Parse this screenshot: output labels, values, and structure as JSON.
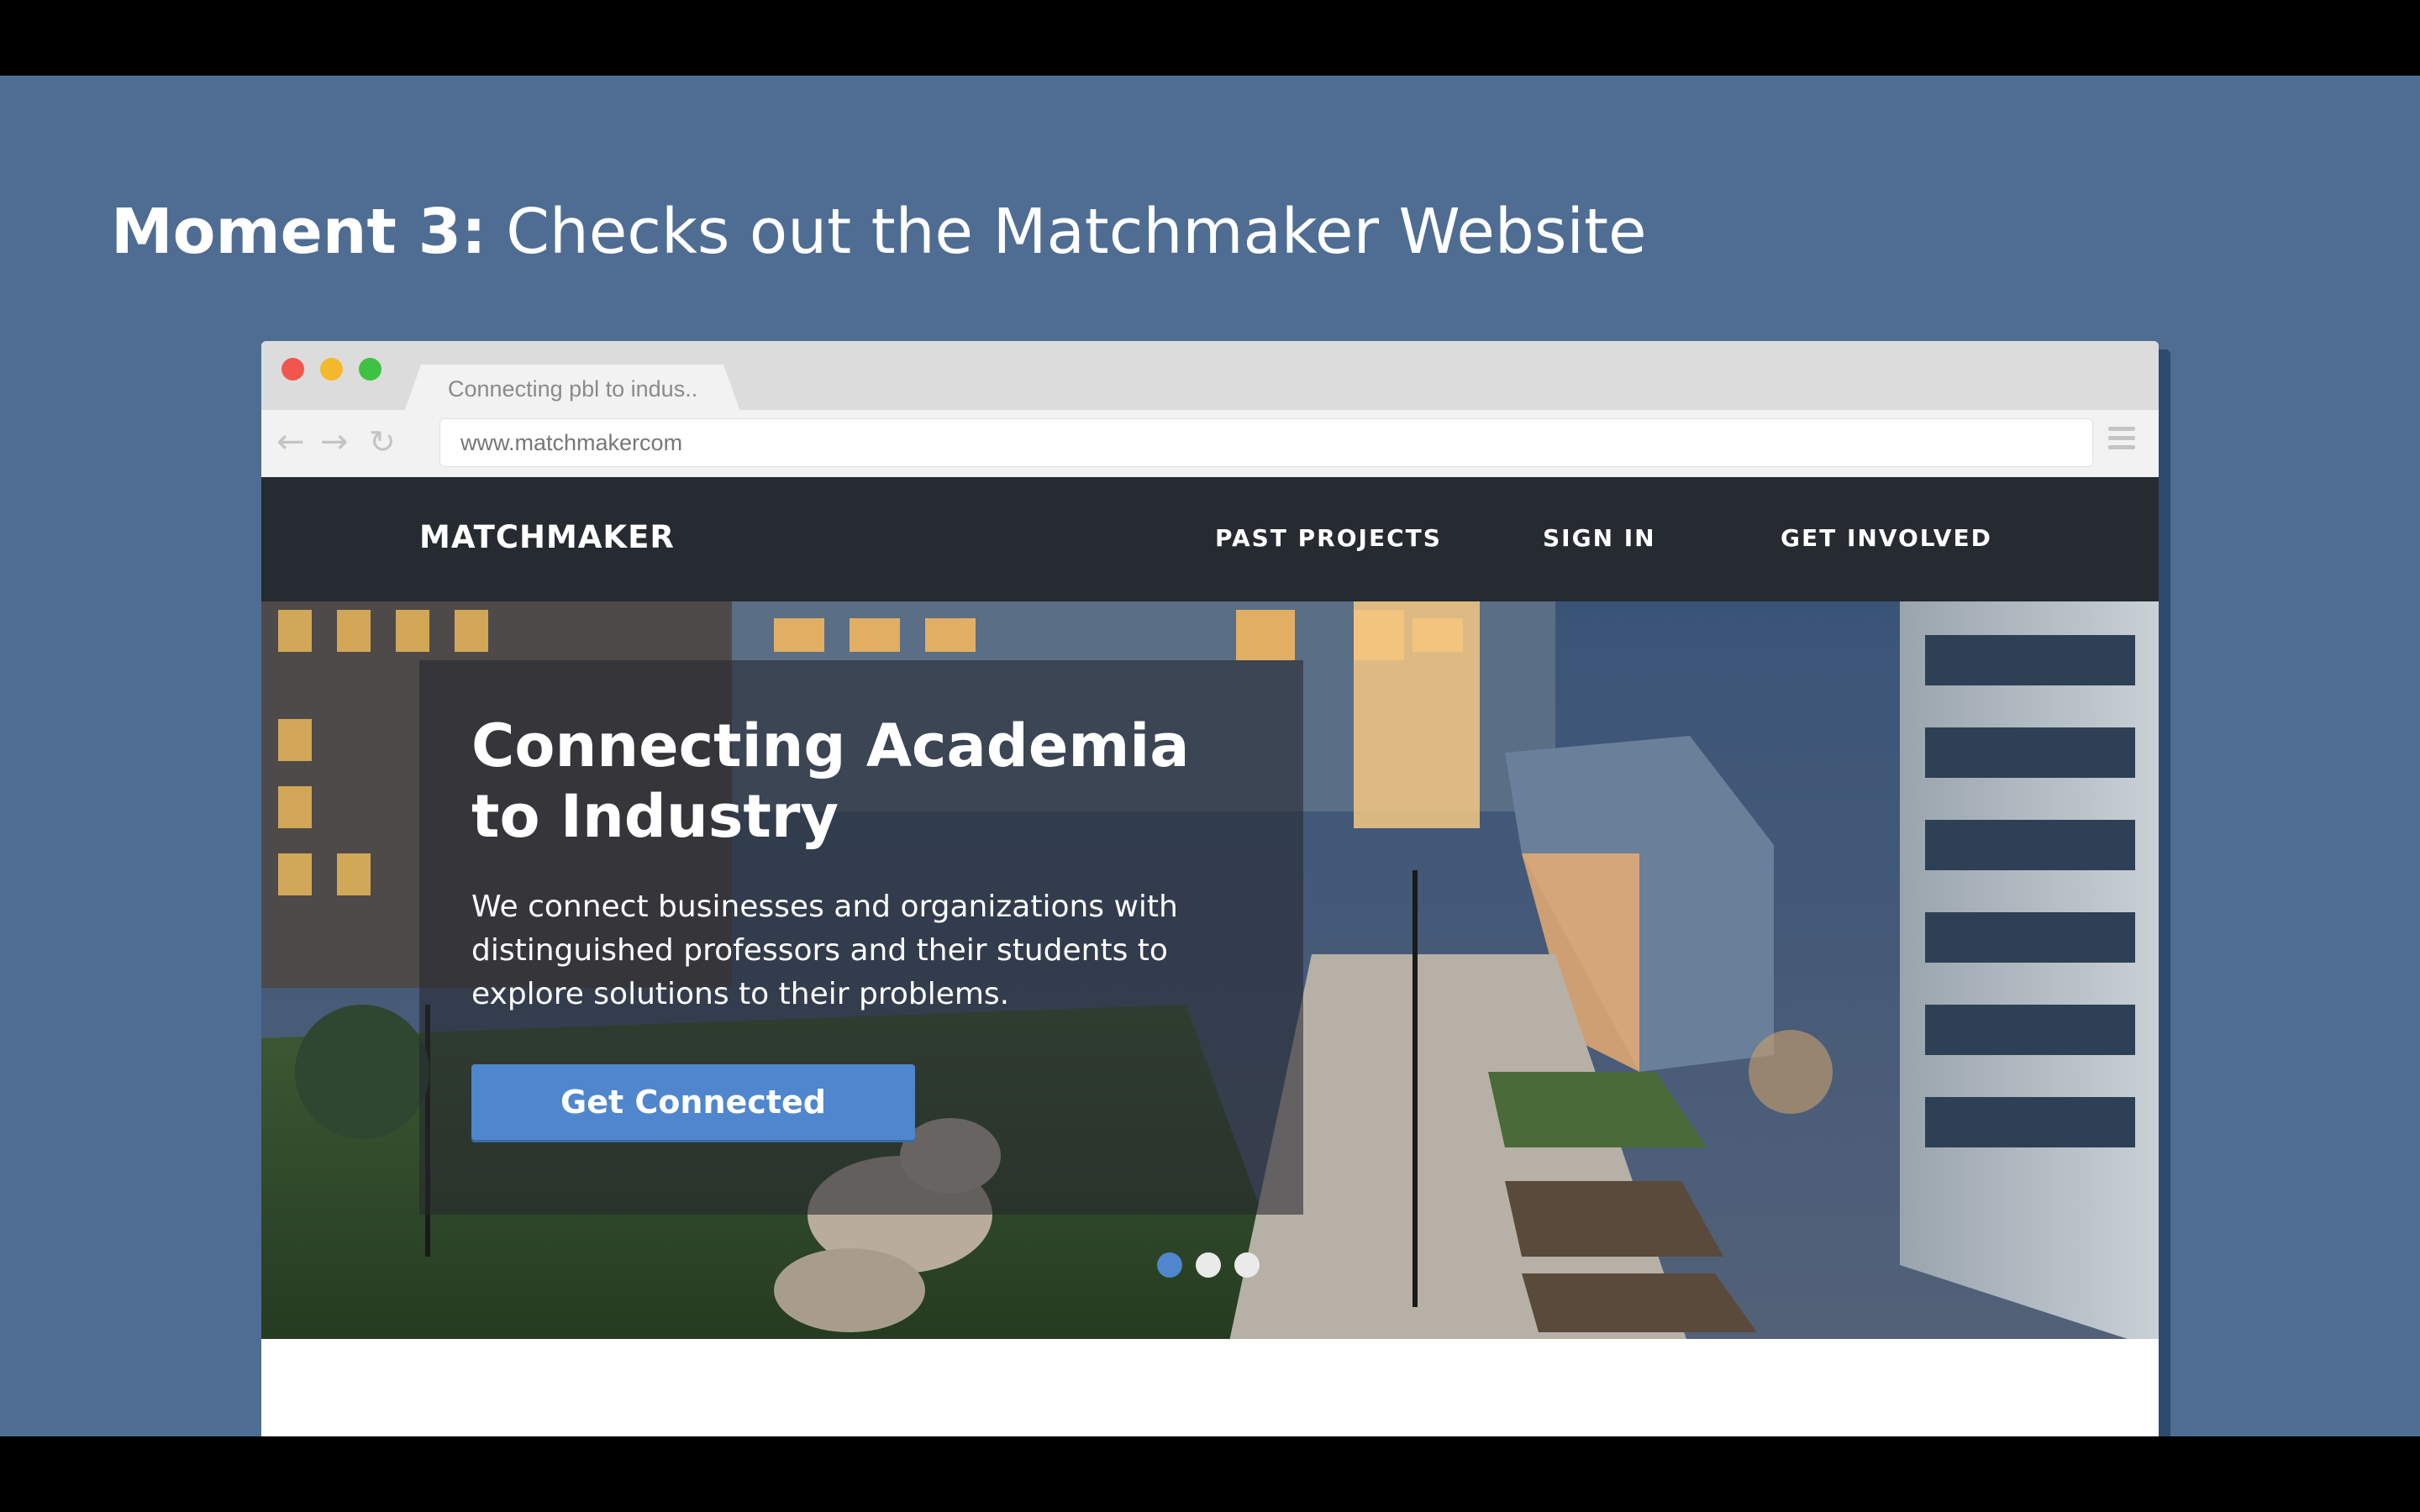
{
  "slide": {
    "title_bold": "Moment 3:",
    "title_rest": " Checks out the Matchmaker Website",
    "background_color": "#4f6d93"
  },
  "browser": {
    "tab_title": "Connecting pbl to indus..",
    "url": "www.matchmakercom",
    "icons": [
      "back-arrow-icon",
      "forward-arrow-icon",
      "reload-icon",
      "hamburger-menu-icon"
    ]
  },
  "site": {
    "brand": "MATCHMAKER",
    "nav": {
      "past_projects": "PAST PROJECTS",
      "sign_in": "SIGN IN",
      "get_involved": "GET INVOLVED"
    },
    "hero": {
      "title": "Connecting Academia to Industry",
      "text": "We connect businesses and organizations with distinguished professors and their students to explore solutions to their problems.",
      "cta_label": "Get Connected",
      "carousel": {
        "slides": 3,
        "active_index": 0
      }
    },
    "colors": {
      "nav_bg": "#262a31",
      "accent": "#4f86cd"
    }
  }
}
